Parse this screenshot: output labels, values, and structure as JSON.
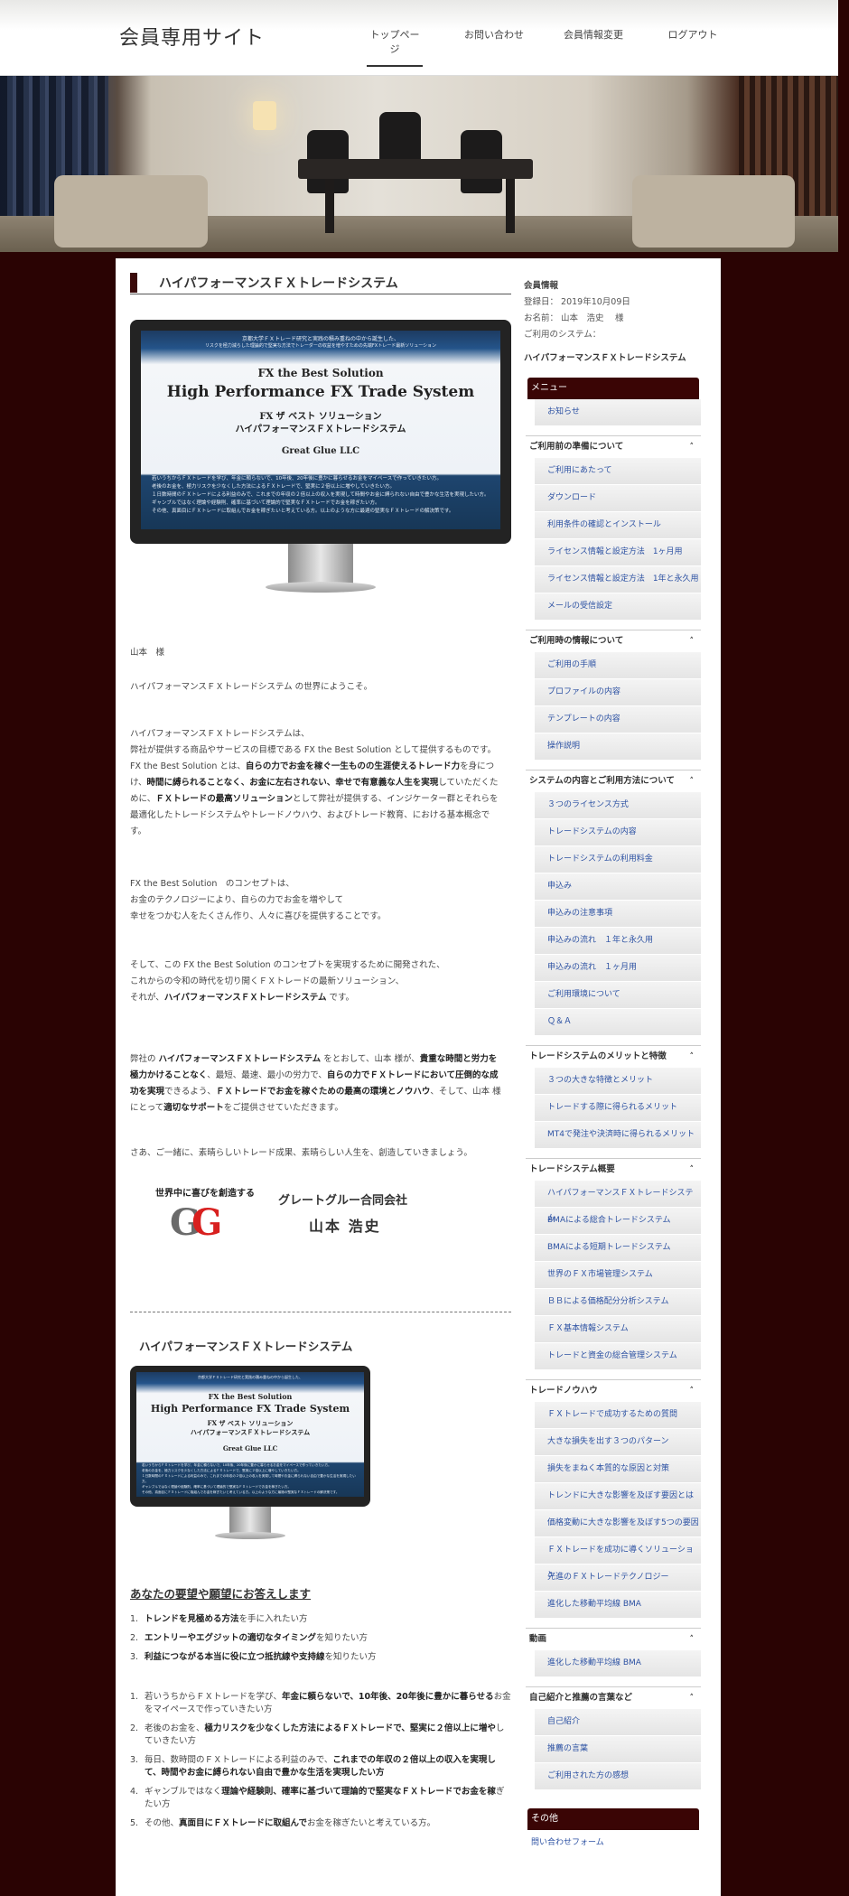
{
  "header": {
    "site_title": "会員専用サイト",
    "nav": [
      "トップページ",
      "お問い合わせ",
      "会員情報変更",
      "ログアウト"
    ]
  },
  "main": {
    "page_title": "ハイパフォーマンスＦＸトレードシステム",
    "hero_screen": {
      "top_line1": "京都大学ＦＸトレード研究と実践の積み重ねの中から誕生した、",
      "top_line2": "リスクを極力減らした理論的で堅実な方法でトレーダーの収益を増やすための先端FXトレード最新ソリューション",
      "title_small": "FX  the Best Solution",
      "title_big": "High Performance FX Trade System",
      "kana1": "FX  ザ ベスト ソリューション",
      "kana2": "ハイパフォーマンスＦＸトレードシステム",
      "company": "Great Glue LLC",
      "body": [
        "若いうちからＦＸトレードを学び、年金に頼らないで、10年後、20年後に豊かに暮らせるお金をマイペースで作っていきたい方。",
        "老後のお金を、極力リスクを少なくした方法によるＦＸトレードで、堅実に２倍以上に増やしていきたい方。",
        "１日数時間のＦＸトレードによる利益のみで、これまでの年収の２倍以上の収入を実現して時間やお金に縛られない自由で豊かな生活を実現したい方。",
        "ギャンブルではなく理論や経験則、確率に基づいて理論的で堅実なＦＸトレードでお金を稼ぎたい方。",
        "その他、真面目にＦＸトレードに取組んでお金を稼ぎたいと考えている方。以上のような方に最適の堅実なＦＸトレードの解決策です。"
      ]
    },
    "greeting": "山本　様",
    "welcome": "ハイパフォーマンスＦＸトレードシステム の世界にようこそ。",
    "para1": {
      "l1": "ハイパフォーマンスＦＸトレードシステムは、",
      "l2": "弊社が提供する商品やサービスの目標である FX the Best Solution として提供するものです。",
      "l3a": "FX the Best Solution とは、",
      "l3b": "自らの力でお金を稼ぐ一生ものの生涯使えるトレード力",
      "l3c": "を身につ",
      "l4a": "け、",
      "l4b": "時間に縛られることなく、お金に左右されない、幸せで有意義な人生を実現",
      "l4c": "していただくた",
      "l5a": "めに、",
      "l5b": "ＦＸトレードの最高ソリューション",
      "l5c": "として弊社が提供する、インジケーター群とそれらを",
      "l6": "最適化したトレードシステムやトレードノウハウ、およびトレード教育、における基本概念で",
      "l7": "す。"
    },
    "para2": {
      "l1": "FX the Best Solution　のコンセプトは、",
      "l2": "お金のテクノロジーにより、自らの力でお金を増やして",
      "l3": "幸せをつかむ人をたくさん作り、人々に喜びを提供することです。"
    },
    "para3": {
      "l1": "そして、この FX the Best Solution のコンセプトを実現するために開発された、",
      "l2": "これからの令和の時代を切り開くＦＸトレードの最新ソリューション、",
      "l3a": "それが、",
      "l3b": "ハイパフォーマンスＦＸトレードシステム",
      "l3c": " です。"
    },
    "para4": {
      "l1a": "弊社の ",
      "l1b": "ハイパフォーマンスＦＸトレードシステム",
      "l1c": " をとおして、山本 様が、",
      "l1d": "貴重な時間と労力を",
      "l2a": "極力かけることなく",
      "l2b": "、最短、最速、最小の労力で、",
      "l2c": "自らの力でＦＸトレードにおいて圧倒的な成",
      "l3a": "功を実現",
      "l3b": "できるよう、",
      "l3c": "ＦＸトレードでお金を稼ぐための最高の環境とノウハウ",
      "l3d": "、そして、山本 様",
      "l4a": "にとって",
      "l4b": "適切なサポート",
      "l4c": "をご提供させていただきます。"
    },
    "closing": "さあ、ご一緒に、素晴らしいトレード成果、素晴らしい人生を、創造していきましょう。",
    "logo": {
      "tagline": "世界中に喜びを創造する",
      "mark_g1": "G",
      "mark_g2": "G",
      "company": "グレートグルー合同会社",
      "name": "山本 浩史"
    },
    "sub_title": "ハイパフォーマンスＦＸトレードシステム",
    "needs_heading": "あなたの要望や願望にお答えします",
    "needs": [
      {
        "num": "1.",
        "bold": "トレンドを見極める方法",
        "rest": "を手に入れたい方"
      },
      {
        "num": "2.",
        "bold": "エントリーやエグジットの適切なタイミング",
        "rest": "を知りたい方"
      },
      {
        "num": "3.",
        "bold": "利益につながる本当に役に立つ抵抗線や支持線",
        "rest": "を知りたい方"
      }
    ],
    "targets": [
      {
        "num": "1.",
        "pre": "若いうちからＦＸトレードを学び、",
        "bold": "年金に頼らないで、10年後、20年後に豊かに暮らせる",
        "post": "お金をマイペースで作っていきたい方"
      },
      {
        "num": "2.",
        "pre": "老後のお金を、",
        "bold": "極力リスクを少なくした方法によるＦＸトレードで、堅実に２倍以上に増や",
        "post": "していきたい方"
      },
      {
        "num": "3.",
        "pre": "毎日、数時間のＦＸトレードによる利益のみで、",
        "bold": "これまでの年収の２倍以上の収入を実現して、時間やお金に縛られない自由で豊かな生活を実現したい方",
        "post": ""
      },
      {
        "num": "4.",
        "pre": "ギャンブルではなく",
        "bold": "理論や経験則、確率に基づいて理論的で堅実なＦＸトレードでお金を稼",
        "post": "ぎたい方"
      },
      {
        "num": "5.",
        "pre": "その他、",
        "bold": "真面目にＦＸトレードに取組んで",
        "post": "お金を稼ぎたいと考えている方。"
      }
    ]
  },
  "sidebar": {
    "member_title": "会員情報",
    "registered": "登録日：  2019年10月09日",
    "name": "お名前：  山本　浩史　 様",
    "system_label": "ご利用のシステム：",
    "system_name": "ハイパフォーマンスＦＸトレードシステム",
    "menu_head": "メニュー",
    "news": "お知らせ",
    "groups": [
      {
        "title": "ご利用前の準備について",
        "items": [
          "ご利用にあたって",
          "ダウンロード",
          "利用条件の確認とインストール",
          "ライセンス情報と設定方法　1ヶ月用",
          "ライセンス情報と設定方法　1年と永久用",
          "メールの受信設定"
        ]
      },
      {
        "title": "ご利用時の情報について",
        "items": [
          "ご利用の手順",
          "プロファイルの内容",
          "テンプレートの内容",
          "操作説明"
        ]
      },
      {
        "title": "システムの内容とご利用方法について",
        "items": [
          "３つのライセンス方式",
          "トレードシステムの内容",
          "トレードシステムの利用料金",
          "申込み",
          "申込みの注意事項",
          "申込みの流れ　１年と永久用",
          "申込みの流れ　１ヶ月用",
          "ご利用環境について",
          "Ｑ＆Ａ"
        ]
      },
      {
        "title": "トレードシステムのメリットと特徴",
        "items": [
          "３つの大きな特徴とメリット",
          "トレードする際に得られるメリット",
          "MT4で発注や決済時に得られるメリット"
        ]
      },
      {
        "title": "トレードシステム概要",
        "items": [
          "ハイパフォーマンスＦＸトレードシステム",
          "BMAによる総合トレードシステム",
          "BMAによる短期トレードシステム",
          "世界のＦＸ市場管理システム",
          "ＢＢによる価格配分分析システム",
          "ＦＸ基本情報システム",
          "トレードと資金の総合管理システム"
        ]
      },
      {
        "title": "トレードノウハウ",
        "items": [
          "ＦＸトレードで成功するための質問",
          "大きな損失を出す３つのパターン",
          "損失をまねく本質的な原因と対策",
          "トレンドに大きな影響を及ぼす要因とは",
          "価格変動に大きな影響を及ぼす5つの要因",
          "ＦＸトレードを成功に導くソリューション",
          "先進のＦＸトレードテクノロジー",
          "進化した移動平均線 BMA"
        ]
      },
      {
        "title": "動画",
        "items": [
          "進化した移動平均線 BMA"
        ]
      },
      {
        "title": "自己紹介と推薦の言葉など",
        "items": [
          "自己紹介",
          "推薦の言葉",
          "ご利用された方の感想"
        ]
      }
    ],
    "other_head": "その他",
    "other_items": [
      "問い合わせフォーム"
    ]
  }
}
